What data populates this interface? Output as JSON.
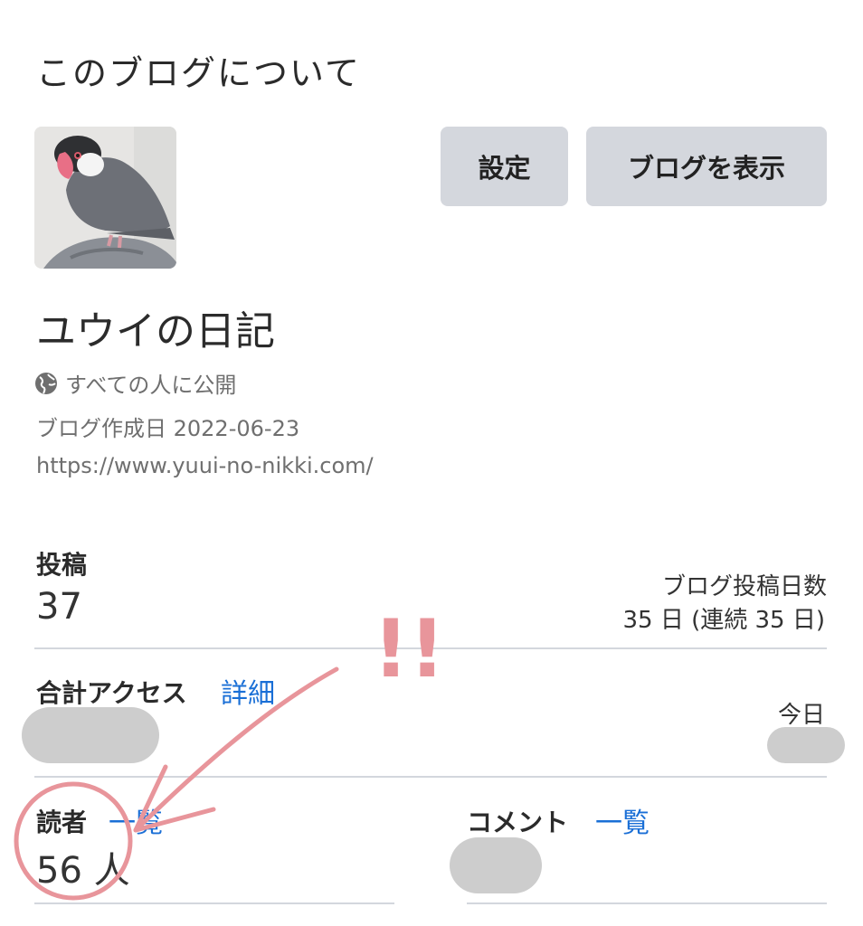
{
  "header": {
    "title": "このブログについて"
  },
  "actions": {
    "settings_label": "設定",
    "view_blog_label": "ブログを表示"
  },
  "blog": {
    "name": "ユウイの日記",
    "visibility_icon": "globe-icon",
    "visibility": "すべての人に公開",
    "created_label": "ブログ作成日 2022-06-23",
    "url": "https://www.yuui-no-nikki.com/"
  },
  "stats": {
    "posts": {
      "label": "投稿",
      "value": "37"
    },
    "post_days": {
      "label": "ブログ投稿日数",
      "value": "35 日 (連続 35 日)"
    },
    "total_access": {
      "label": "合計アクセス",
      "link": "詳細",
      "today_label": "今日"
    },
    "readers": {
      "label": "読者",
      "link": "一覧",
      "value": "56 人"
    },
    "comments": {
      "label": "コメント",
      "link": "一覧"
    }
  },
  "annotation": {
    "exclaim": "!!",
    "color": "#e8959b"
  },
  "colors": {
    "link": "#1a6fd6",
    "button_bg": "#d4d7dd",
    "divider": "#d3d7dd",
    "blur": "#cdcdcd"
  }
}
